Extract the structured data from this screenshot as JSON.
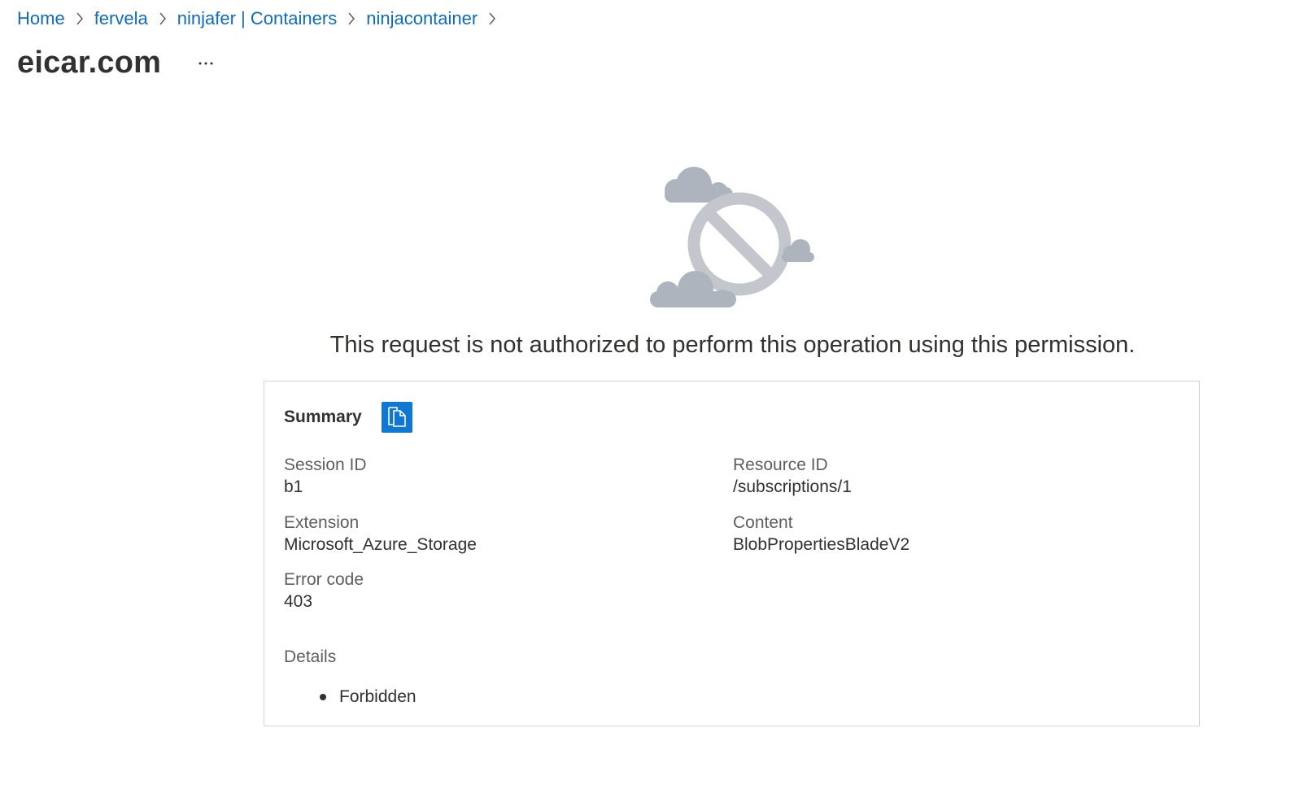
{
  "breadcrumb": {
    "items": [
      {
        "label": "Home"
      },
      {
        "label": "fervela"
      },
      {
        "label": "ninjafer | Containers"
      },
      {
        "label": "ninjacontainer"
      }
    ]
  },
  "header": {
    "title": "eicar.com",
    "more_icon": "ellipsis-icon"
  },
  "error": {
    "illustration_icon": "blocked-cloud-icon",
    "message": "This request is not authorized to perform this operation using this permission."
  },
  "summary": {
    "title": "Summary",
    "copy_icon": "copy-icon",
    "session_id": {
      "label": "Session ID",
      "value": "b1"
    },
    "resource_id": {
      "label": "Resource ID",
      "value": "/subscriptions/1"
    },
    "extension": {
      "label": "Extension",
      "value": "Microsoft_Azure_Storage"
    },
    "content": {
      "label": "Content",
      "value": "BlobPropertiesBladeV2"
    },
    "error_code": {
      "label": "Error code",
      "value": "403"
    },
    "details": {
      "label": "Details",
      "items": [
        "Forbidden"
      ]
    }
  },
  "colors": {
    "link": "#0f6cbd",
    "accent": "#0f78d4",
    "illustration": "#aeb4bd",
    "border": "#d6d6d6"
  }
}
